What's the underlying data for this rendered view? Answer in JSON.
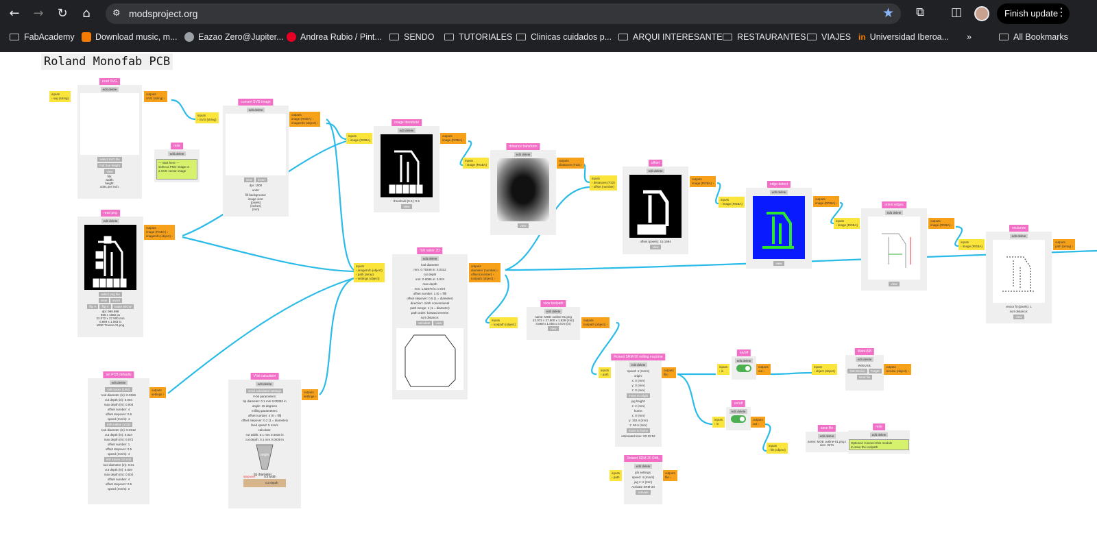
{
  "browser": {
    "url": "modsproject.org",
    "finish_update": "Finish update"
  },
  "bookmarks": [
    {
      "label": "FabAcademy",
      "icon": "folder-icon"
    },
    {
      "label": "Download music, m...",
      "icon": "blogger-icon"
    },
    {
      "label": "Eazao Zero@Jupiter...",
      "icon": "site-icon"
    },
    {
      "label": "Andrea Rubio / Pint...",
      "icon": "pinterest-icon"
    },
    {
      "label": "SENDO",
      "icon": "folder-icon"
    },
    {
      "label": "TUTORIALES",
      "icon": "folder-icon"
    },
    {
      "label": "Clinicas cuidados p...",
      "icon": "folder-icon"
    },
    {
      "label": "ARQUI INTERESANTE",
      "icon": "folder-icon"
    },
    {
      "label": "RESTAURANTES",
      "icon": "folder-icon"
    },
    {
      "label": "VIAJES",
      "icon": "folder-icon"
    },
    {
      "label": "Universidad Iberoa...",
      "icon": "ibero-icon"
    }
  ],
  "all_bookmarks": "All Bookmarks",
  "page_title": "Roland Monofab PCB",
  "common": {
    "edit_delete": "edit delete",
    "inputs": "inputs",
    "outputs": "outputs",
    "view": "view"
  },
  "modules": {
    "read_svg": {
      "title": "read SVG",
      "input": "svg (string)",
      "output": "SVG (string)",
      "btn1": "select SVG file",
      "btn2": "Full true height",
      "info": "file:\nwidth:\nheight:\nunits per inch:"
    },
    "convert_svg": {
      "title": "convert SVG image",
      "input": "SVG (string)",
      "output1": "image (RGBA)",
      "output2": "imageInfo (object)",
      "dpi": "dpi: 1000",
      "units": "units:",
      "fill": "fill background:",
      "size": "image size:\n(pixels)\n(inches)\n(mm)",
      "invert": "invert"
    },
    "note1": {
      "title": "note",
      "text": "--- start here ---\nselect a PNG image or\na SVG vector image"
    },
    "read_png": {
      "title": "read png",
      "output1": "image (RGBA)",
      "output2": "imageInfo (object)",
      "select": "select png file",
      "flipH": "flip H",
      "flipV": "flip V",
      "rotate": "rotate 90CW",
      "info": "dpi: 999.998\n866 x 1082 px\n22.072 x 27.500 mm\n0.869 x 1.083 in\nMOE Traces-01.png"
    },
    "threshold": {
      "title": "image threshold",
      "input": "image (RGBA)",
      "output": "image (RGBA)",
      "threshold": "threshold (0-1): 0.5"
    },
    "distance": {
      "title": "distance transform",
      "input": "image (RGBA)",
      "output": "distances (F32)"
    },
    "offset": {
      "title": "offset",
      "input1": "distances (F32)",
      "input2": "offset (number)",
      "output": "image (RGBA)",
      "label": "offset (pixels): 15.1994"
    },
    "edge": {
      "title": "edge detect",
      "input": "image (RGBA)",
      "output": "image (RGBA)"
    },
    "orient": {
      "title": "orient edges",
      "input": "image (RGBA)",
      "output": "image (RGBA)"
    },
    "vectorize": {
      "title": "vectorize",
      "input": "image (RGBA)",
      "output": "path (array)",
      "fit": "vector fit (pixels): 1",
      "sort": "sort distance:"
    },
    "mill_raster": {
      "title": "mill raster 2D",
      "input1": "imageInfo (object)",
      "input2": "path (array)",
      "input3": "settings (object)",
      "output1": "diameter (number)",
      "output2": "offset (number)",
      "output3": "toolpath (object)",
      "rows": [
        "tool diameter",
        "mm: 0.79248  in: 0.0312",
        "cut depth",
        "mm: 0.6096  in: 0.024",
        "max depth",
        "mm: 1.82879  in: 0.072",
        "offset number: 1  (0 = fill)",
        "offset stepover: 0.5  (1 = diameter)",
        "direction: climb  conventional",
        "path merge: 1  (1 = diameter)",
        "path order: forward  reverse",
        "sort distance:"
      ],
      "calc": "calculate"
    },
    "view_toolpath": {
      "title": "view toolpath",
      "input": "toolpath (object)",
      "output": "toolpath (object)",
      "info": "name: MOE outline-01.png\n22.072 x 27.500 x 1.829 (mm)\n0.869 x 1.083 x 0.072 (in)"
    },
    "set_pcb": {
      "title": "set PCB defaults",
      "output": "settings",
      "rows": [
        "mill traces (1/64)",
        "tool diameter (in): 0.0156",
        "cut depth (in): 0.004",
        "max depth (in): 0.004",
        "offset number: 4",
        "offset stepover: 0.5",
        "speed (mm/s): 4",
        "mill outline (1/32)",
        "tool diameter (in): 0.0312",
        "cut depth (in): 0.024",
        "max depth (in): 0.072",
        "offset number: 1",
        "offset stepover: 0.5",
        "speed (mm/s): 4",
        "mill traces (10 mil)",
        "tool diameter (in): 0.01",
        "cut depth (in): 0.004",
        "max depth (in): 0.004",
        "offset number: 4",
        "offset stepover: 0.5",
        "speed (mm/s): 2"
      ]
    },
    "vbit": {
      "title": "V-bit calculator",
      "output": "settings",
      "send": "send calculated settings",
      "rows": [
        "V-bit parameters:",
        "tip diameter: 0.1  mm  0.00393  in",
        "angle: 15  degrees",
        "milling parameters:",
        "offset number: 4  (0 = fill)",
        "offset stepover: 0.2  (1 = diameter)",
        "feed speed: 5  mm/s",
        "calculate:",
        "cut width: 0.1  mm  0.0039  in",
        "cut depth: 0.1  mm  0.0039  in"
      ],
      "angle": "angle",
      "tip": "tip diameter",
      "stepover": "stepover",
      "cutwidth": "cut width",
      "cutdepth": "cut depth"
    },
    "roland_mill": {
      "title": "Roland SRM-20 milling machine",
      "input": "path",
      "output": "file",
      "rows": [
        "speed: 4  (mm/s)",
        "origin:",
        "x: 0  (mm)",
        "y: 0  (mm)",
        "z: 0  (mm)",
        "jog height:",
        "z: 2  (mm)",
        "home:",
        "x: 0  (mm)",
        "y: 152.4  (mm)",
        "z: 60.5  (mm)"
      ],
      "origin_btn": "move to origin",
      "home_btn": "move to home",
      "time": "estimated time: 00:12:52"
    },
    "roland_rml": {
      "title": "Roland SRM-20 RML",
      "input": "path",
      "output": "file",
      "rows": [
        "job settings:",
        "speed: 4  (mm/s)",
        "jog z: 2  (mm)",
        "Activate SRM-20"
      ],
      "activate": "activate"
    },
    "onoff1": {
      "title": "on/off",
      "input": "in",
      "output": "out"
    },
    "onoff2": {
      "title": "on/off",
      "input": "in",
      "output": "out"
    },
    "websocket": {
      "title": "WebUSB",
      "input": "object (object)",
      "output": "receive (object)",
      "label": "WebUSB:",
      "get": "Get Device",
      "forget": "Forget",
      "send": "send file"
    },
    "save_file": {
      "title": "save file",
      "input": "file (object)",
      "info": "name: MOE outline-01.png.r\nsize: 3271"
    },
    "note2": {
      "title": "note",
      "text": "Optional: Connect this module\nto save the toolpath"
    }
  }
}
